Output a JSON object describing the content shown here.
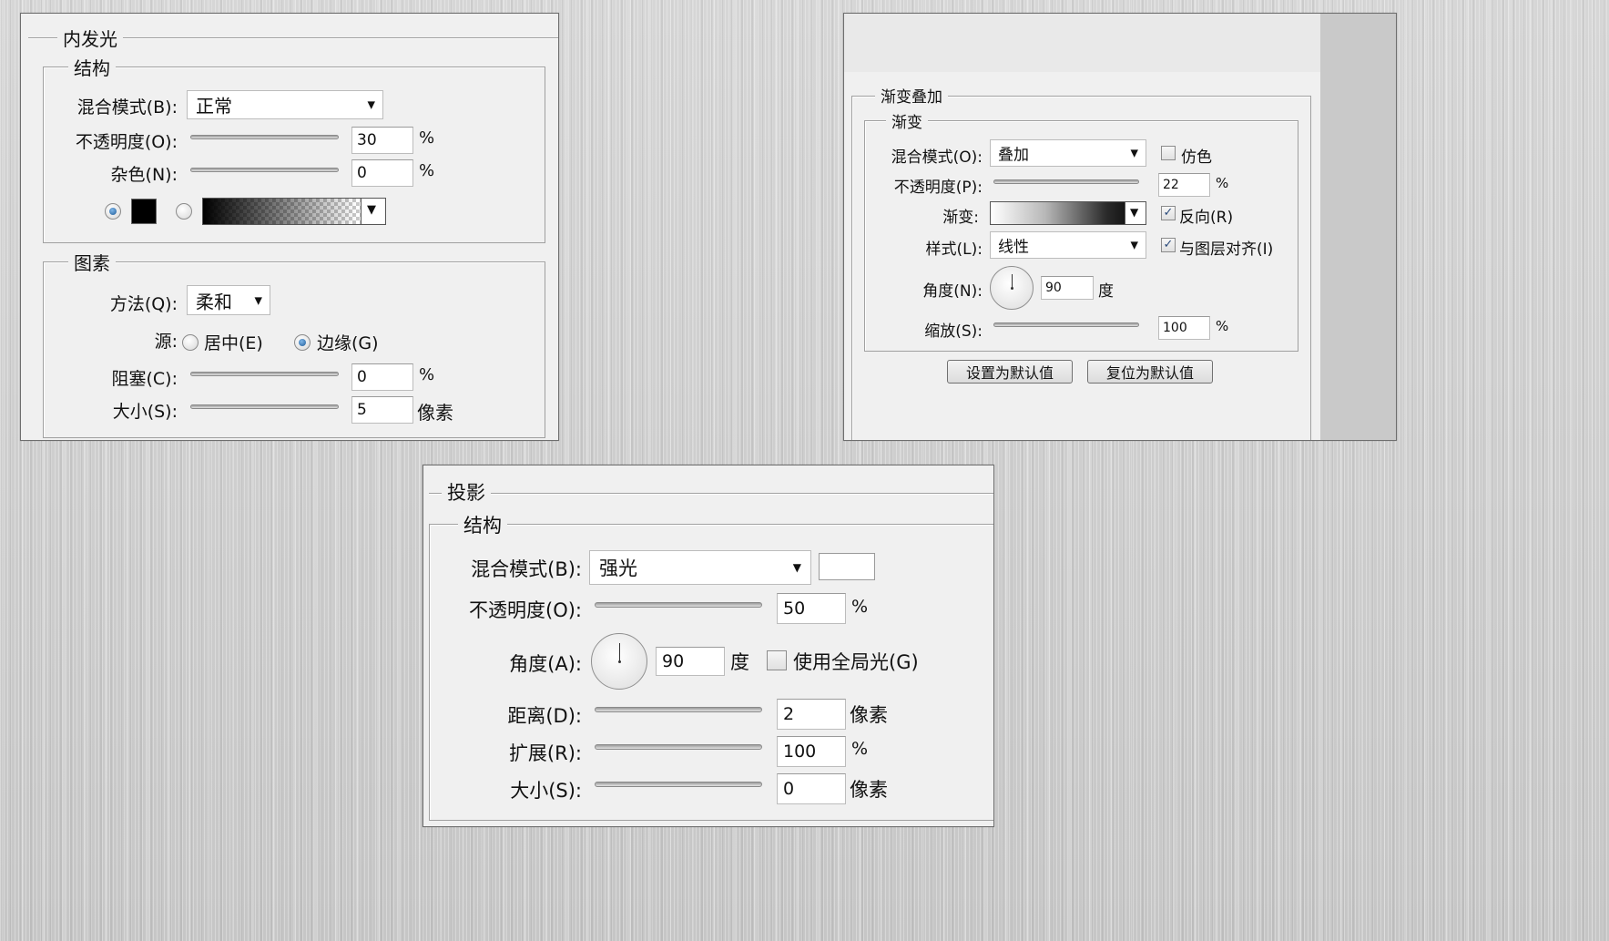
{
  "inner_glow": {
    "title": "内发光",
    "structure": {
      "title": "结构",
      "blend_mode_label": "混合模式(B):",
      "blend_mode_value": "正常",
      "opacity_label": "不透明度(O):",
      "opacity_value": "30",
      "opacity_unit": "%",
      "opacity_slider": 0.3,
      "noise_label": "杂色(N):",
      "noise_value": "0",
      "noise_unit": "%",
      "noise_slider": 0.0,
      "fill_color": "#000000"
    },
    "elements": {
      "title": "图素",
      "method_label": "方法(Q):",
      "method_value": "柔和",
      "source_label": "源:",
      "source_center_label": "居中(E)",
      "source_edge_label": "边缘(G)",
      "choke_label": "阻塞(C):",
      "choke_value": "0",
      "choke_unit": "%",
      "choke_slider": 0.0,
      "size_label": "大小(S):",
      "size_value": "5",
      "size_unit": "像素",
      "size_slider": 0.04
    }
  },
  "gradient_overlay": {
    "title": "渐变叠加",
    "gradient_section": {
      "title": "渐变",
      "blend_mode_label": "混合模式(O):",
      "blend_mode_value": "叠加",
      "dither_label": "仿色",
      "dither_checked": false,
      "opacity_label": "不透明度(P):",
      "opacity_value": "22",
      "opacity_unit": "%",
      "opacity_slider": 0.22,
      "gradient_label": "渐变:",
      "reverse_label": "反向(R)",
      "reverse_checked": true,
      "style_label": "样式(L):",
      "style_value": "线性",
      "align_label": "与图层对齐(I)",
      "align_checked": true,
      "angle_label": "角度(N):",
      "angle_value": "90",
      "angle_unit": "度",
      "scale_label": "缩放(S):",
      "scale_value": "100",
      "scale_unit": "%",
      "scale_slider": 0.6
    },
    "set_default_button": "设置为默认值",
    "reset_default_button": "复位为默认值"
  },
  "drop_shadow": {
    "title": "投影",
    "structure": {
      "title": "结构",
      "blend_mode_label": "混合模式(B):",
      "blend_mode_value": "强光",
      "shadow_color": "#ffffff",
      "opacity_label": "不透明度(O):",
      "opacity_value": "50",
      "opacity_unit": "%",
      "opacity_slider": 0.5,
      "angle_label": "角度(A):",
      "angle_value": "90",
      "angle_unit": "度",
      "global_light_label": "使用全局光(G)",
      "global_light_checked": false,
      "distance_label": "距离(D):",
      "distance_value": "2",
      "distance_unit": "像素",
      "distance_slider": 0.0,
      "spread_label": "扩展(R):",
      "spread_value": "100",
      "spread_unit": "%",
      "spread_slider": 1.0,
      "size_label": "大小(S):",
      "size_value": "0",
      "size_unit": "像素",
      "size_slider": 0.0
    }
  }
}
